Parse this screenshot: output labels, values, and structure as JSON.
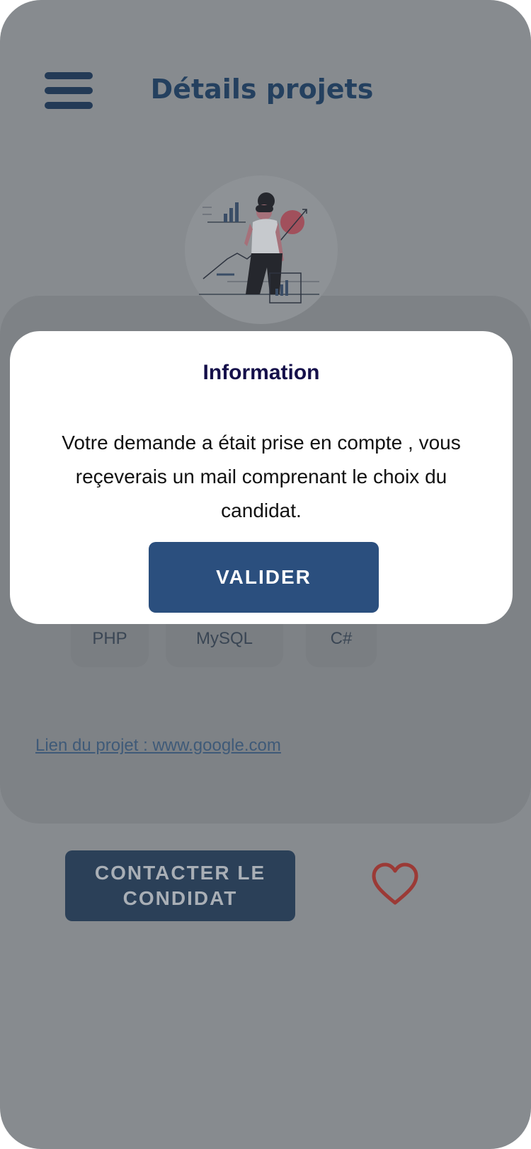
{
  "header": {
    "title": "Détails projets"
  },
  "project": {
    "tags": [
      "PHP",
      "MySQL",
      "C#"
    ],
    "link_text": "Lien du projet : www.google.com"
  },
  "actions": {
    "contact_label": "CONTACTER LE CONDIDAT"
  },
  "dialog": {
    "title": "Information",
    "message": "Votre demande a était prise en compte , vous reçeverais un mail comprenant le choix du candidat.",
    "validate_label": "VALIDER"
  },
  "icons": {
    "menu": "hamburger-menu-icon",
    "favorite": "heart-icon",
    "illustration": "analytics-woman-illustration"
  },
  "colors": {
    "primary": "#2b4f7e",
    "title_text": "#24405f",
    "dialog_title": "#15104a",
    "heart": "#9b3a36",
    "overlay": "#878b8f"
  }
}
